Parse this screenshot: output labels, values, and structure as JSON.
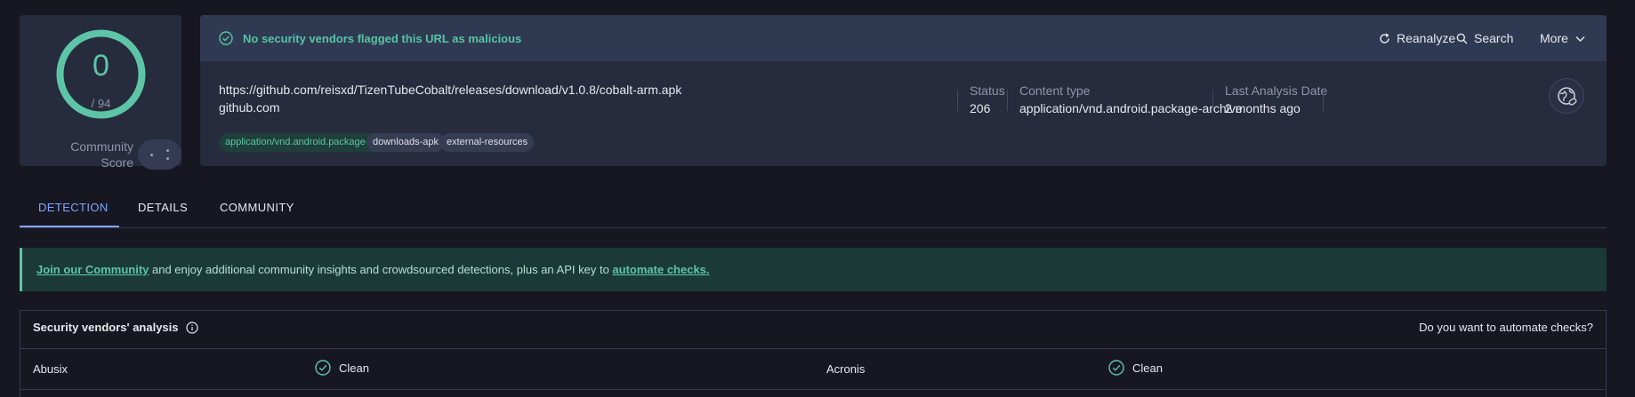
{
  "score": {
    "detections": 0,
    "total_label": "/ 94",
    "detections_fraction": 0,
    "community_label_line1": "Community",
    "community_label_line2": "Score"
  },
  "banner": {
    "status_text": "No security vendors flagged this URL as malicious",
    "actions": {
      "reanalyze": "Reanalyze",
      "search": "Search",
      "more": "More"
    }
  },
  "target": {
    "url": "https://github.com/reisxd/TizenTubeCobalt/releases/download/v1.0.8/cobalt-arm.apk",
    "domain": "github.com",
    "tags": [
      "application/vnd.android.package-archive",
      "downloads-apk",
      "external-resources"
    ]
  },
  "meta": {
    "status_label": "Status",
    "status_value": "206",
    "content_type_label": "Content type",
    "content_type_value": "application/vnd.android.package-archive",
    "last_analysis_label": "Last Analysis Date",
    "last_analysis_value": "2 months ago"
  },
  "tabs": [
    {
      "label": "DETECTION",
      "active": true
    },
    {
      "label": "DETAILS",
      "active": false
    },
    {
      "label": "COMMUNITY",
      "active": false
    }
  ],
  "notice": {
    "link1": "Join our Community",
    "middle": " and enjoy additional community insights and crowdsourced detections, plus an API key to ",
    "link2": "automate checks."
  },
  "analysis": {
    "title": "Security vendors' analysis",
    "cta": "Do you want to automate checks?",
    "rows": [
      {
        "vendor": "Abusix",
        "result": "Clean"
      },
      {
        "vendor": "Acronis",
        "result": "Clean"
      }
    ]
  },
  "colors": {
    "clean": "#5dc5a6",
    "accent": "#7fa6ff",
    "card": "#262b3d",
    "background": "#171722"
  }
}
